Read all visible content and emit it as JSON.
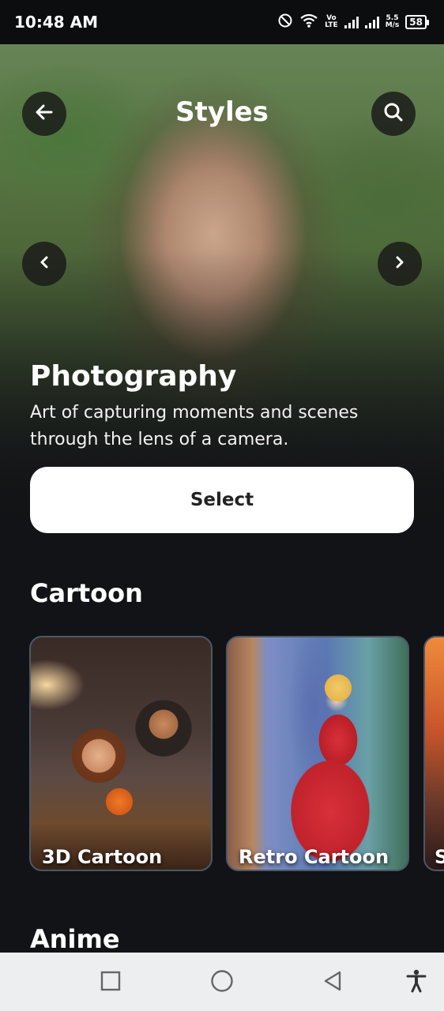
{
  "status_bar": {
    "time": "10:48 AM",
    "network_label_top": "Vo",
    "network_label_bottom": "LTE",
    "speed_top": "5.5",
    "speed_bottom": "M/s",
    "battery": "58"
  },
  "header": {
    "title": "Styles"
  },
  "hero": {
    "style_name": "Photography",
    "description": "Art of capturing moments and scenes through the lens of a camera.",
    "select_label": "Select"
  },
  "sections": [
    {
      "title": "Cartoon",
      "cards": [
        {
          "label": "3D Cartoon"
        },
        {
          "label": "Retro Cartoon"
        },
        {
          "label": "S"
        }
      ]
    },
    {
      "title": "Anime"
    }
  ],
  "icons": {
    "back": "arrow-left-icon",
    "search": "search-icon",
    "prev": "chevron-left-icon",
    "next": "chevron-right-icon"
  }
}
